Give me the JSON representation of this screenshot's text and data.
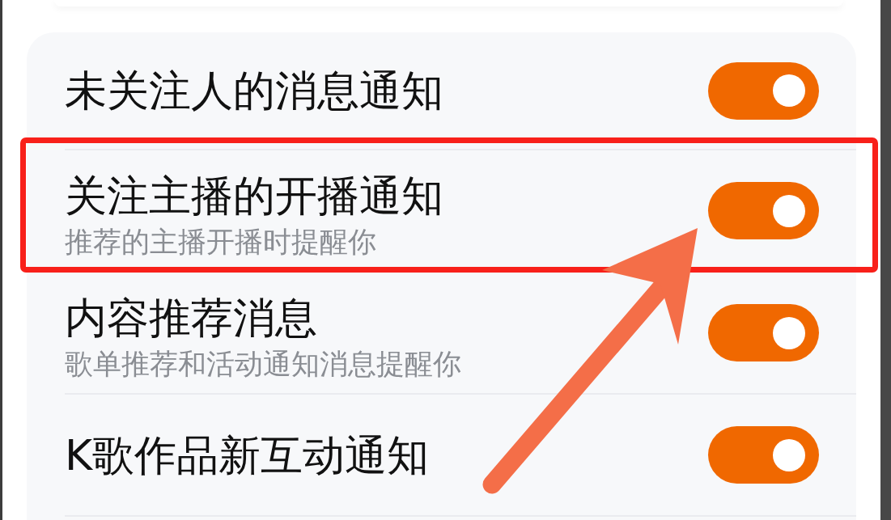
{
  "settings_list": {
    "rows": [
      {
        "title": "未关注人的消息通知",
        "on": true,
        "highlighted": false
      },
      {
        "title": "关注主播的开播通知",
        "description": "推荐的主播开播时提醒你",
        "on": true,
        "highlighted": true
      },
      {
        "title": "内容推荐消息",
        "description": "歌单推荐和活动通知消息提醒你",
        "on": true,
        "highlighted": false
      },
      {
        "title": "K歌作品新互动通知",
        "on": true,
        "highlighted": false
      }
    ]
  }
}
